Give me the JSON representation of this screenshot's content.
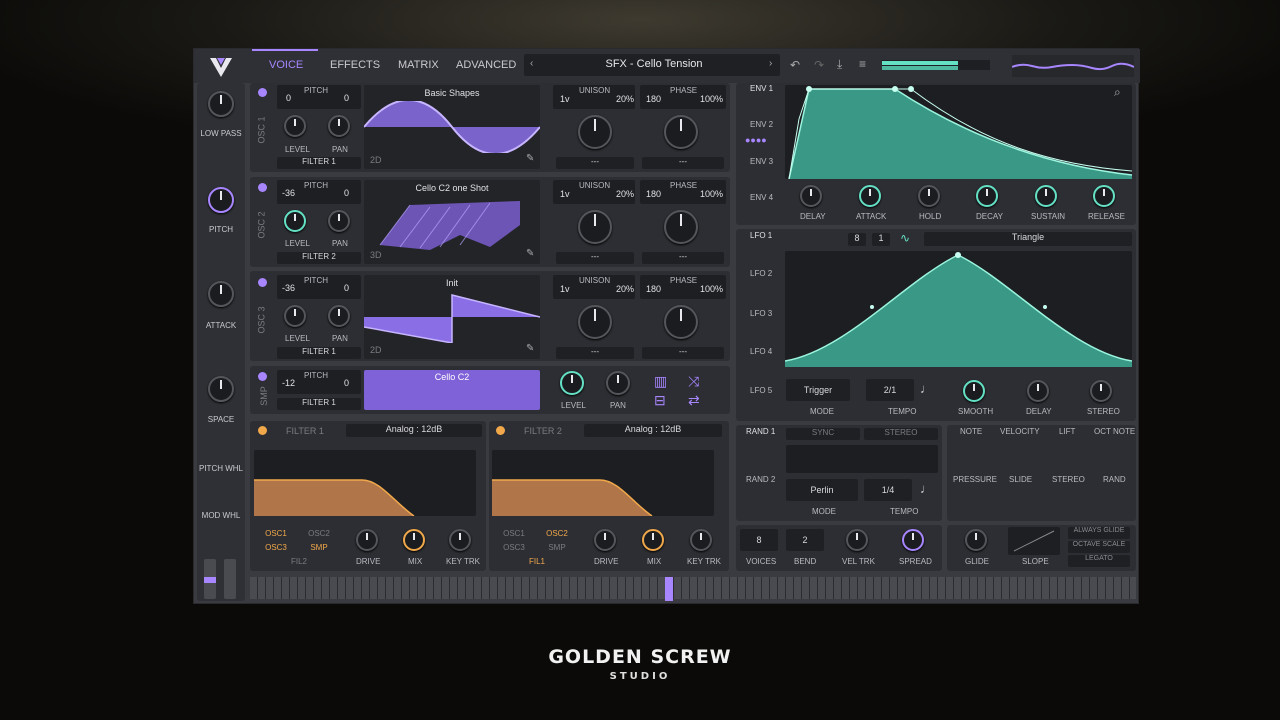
{
  "header": {
    "tabs": [
      "VOICE",
      "EFFECTS",
      "MATRIX",
      "ADVANCED"
    ],
    "preset": "SFX - Cello Tension"
  },
  "left_macros": [
    "LOW PASS",
    "PITCH",
    "ATTACK",
    "SPACE",
    "PITCH WHL",
    "MOD WHL"
  ],
  "osc": [
    {
      "name": "OSC 1",
      "pitch_l": "0",
      "pitch_r": "0",
      "wave": "Basic Shapes",
      "mode": "2D",
      "filter": "FILTER 1"
    },
    {
      "name": "OSC 2",
      "pitch_l": "-36",
      "pitch_r": "0",
      "wave": "Cello C2 one Shot",
      "mode": "3D",
      "filter": "FILTER 2"
    },
    {
      "name": "OSC 3",
      "pitch_l": "-36",
      "pitch_r": "0",
      "wave": "Init",
      "mode": "2D",
      "filter": "FILTER 1"
    }
  ],
  "osc_labels": {
    "pitch": "PITCH",
    "level": "LEVEL",
    "pan": "PAN",
    "unison": "UNISON",
    "phase": "PHASE",
    "voices": "1v",
    "detune": "20%",
    "phase_val": "180",
    "rand": "100%",
    "dash": "---"
  },
  "smp": {
    "name": "SMP",
    "pitch_l": "-12",
    "pitch_r": "0",
    "sample": "Cello C2",
    "filter": "FILTER 1",
    "level": "LEVEL",
    "pan": "PAN"
  },
  "filters": [
    {
      "name": "FILTER 1",
      "type": "Analog : 12dB",
      "src": [
        "OSC1",
        "OSC2",
        "OSC3",
        "SMP"
      ],
      "route": "FIL2",
      "knobs": [
        "DRIVE",
        "MIX",
        "KEY TRK"
      ]
    },
    {
      "name": "FILTER 2",
      "type": "Analog : 12dB",
      "src": [
        "OSC1",
        "OSC2",
        "OSC3",
        "SMP"
      ],
      "route": "FIL1",
      "knobs": [
        "DRIVE",
        "MIX",
        "KEY TRK"
      ]
    }
  ],
  "env": {
    "tabs": [
      "ENV 1",
      "ENV 2",
      "ENV 3",
      "ENV 4"
    ],
    "knobs": [
      "DELAY",
      "ATTACK",
      "HOLD",
      "DECAY",
      "SUSTAIN",
      "RELEASE"
    ]
  },
  "lfo": {
    "tabs": [
      "LFO 1",
      "LFO 2",
      "LFO 3",
      "LFO 4",
      "LFO 5"
    ],
    "shape": "Triangle",
    "grid_a": "8",
    "grid_b": "1",
    "mode": "Trigger",
    "tempo": "2/1",
    "labels": [
      "MODE",
      "TEMPO",
      "SMOOTH",
      "DELAY",
      "STEREO"
    ]
  },
  "rand": {
    "tabs": [
      "RAND 1",
      "RAND 2"
    ],
    "sync": "SYNC",
    "stereo": "STEREO",
    "mode": "Perlin",
    "tempo": "1/4",
    "labels": [
      "MODE",
      "TEMPO"
    ]
  },
  "mod_sources": [
    "NOTE",
    "VELOCITY",
    "LIFT",
    "OCT NOTE",
    "PRESSURE",
    "SLIDE",
    "STEREO",
    "RAND"
  ],
  "voice": {
    "voices": "8",
    "bend": "2",
    "labels": [
      "VOICES",
      "BEND",
      "VEL TRK",
      "SPREAD",
      "GLIDE",
      "SLOPE"
    ],
    "options": [
      "ALWAYS GLIDE",
      "OCTAVE SCALE",
      "LEGATO"
    ]
  },
  "brand": {
    "line1": "GOLDEN SCREW",
    "line2": "STUDIO"
  },
  "colors": {
    "accent": "#a786ff",
    "teal": "#64e0c4",
    "orange": "#f0a84a"
  }
}
